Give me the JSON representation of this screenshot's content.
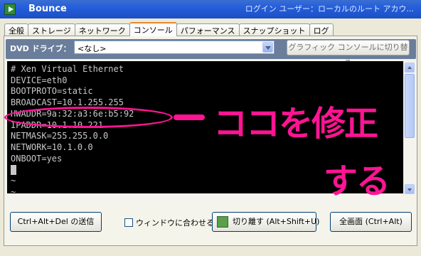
{
  "window": {
    "title": "Bounce",
    "user_label": "ログイン ユーザー：ローカルのルート アカウ..."
  },
  "tabs": [
    {
      "label": "全般"
    },
    {
      "label": "ストレージ"
    },
    {
      "label": "ネットワーク"
    },
    {
      "label": "コンソール",
      "active": true
    },
    {
      "label": "パフォーマンス"
    },
    {
      "label": "スナップショット"
    },
    {
      "label": "ログ"
    }
  ],
  "dvd": {
    "label": "DVD ドライブ：",
    "selected": "<なし>",
    "graphic_console_button": "グラフィック コンソールに切り替え"
  },
  "console": {
    "lines": [
      "# Xen Virtual Ethernet",
      "DEVICE=eth0",
      "BOOTPROTO=static",
      "BROADCAST=10.1.255.255",
      "HWADDR=9a:32:a3:6e:b5:92",
      "IPADDR=10.1.10.221",
      "NETMASK=255.255.0.0",
      "NETWORK=10.1.0.0",
      "ONBOOT=yes",
      "",
      "~",
      "~"
    ]
  },
  "annotation": {
    "line1": "ココを修正",
    "line2": "する",
    "color": "#ff1493"
  },
  "bottom": {
    "ctrl_alt_del": "Ctrl+Alt+Del の送信",
    "fit_window": "ウィンドウに合わせる",
    "detach": "切り離す (Alt+Shift+U)",
    "fullscreen": "全画面 (Ctrl+Alt)"
  }
}
